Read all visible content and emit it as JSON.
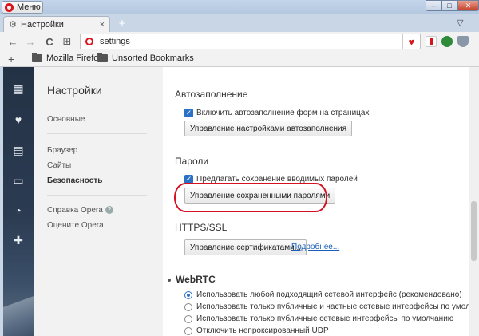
{
  "titlebar": {
    "menu_label": "Меню",
    "minimize": "–",
    "maximize": "□",
    "close": "✕"
  },
  "tab": {
    "label": "Настройки",
    "close": "×",
    "new_tab": "+",
    "tab_menu": "▽"
  },
  "toolbar": {
    "back": "←",
    "forward": "→",
    "reload": "C",
    "speed_dial": "⊞",
    "url": "settings",
    "bookmark": "♥"
  },
  "bookmarks": {
    "add": "+",
    "items": [
      "Mozilla Firefox",
      "Unsorted Bookmarks"
    ]
  },
  "rail": {
    "icons": [
      "▦",
      "♥",
      "▤",
      "▭",
      "◔",
      "✚"
    ]
  },
  "nav": {
    "title": "Настройки",
    "items": {
      "basic": "Основные",
      "browser": "Браузер",
      "sites": "Сайты",
      "security": "Безопасность",
      "help": "Справка Opera",
      "rate": "Оцените Opera"
    },
    "help_icon": "?"
  },
  "content": {
    "autofill": {
      "title": "Автозаполнение",
      "checkbox": "Включить автозаполнение форм на страницах",
      "button": "Управление настройками автозаполнения"
    },
    "passwords": {
      "title": "Пароли",
      "checkbox": "Предлагать сохранение вводимых паролей",
      "button": "Управление сохраненными паролями"
    },
    "https": {
      "title": "HTTPS/SSL",
      "button": "Управление сертификатами...",
      "link": "Подробнее..."
    },
    "webrtc": {
      "title": "WebRTC",
      "options": [
        "Использовать любой подходящий сетевой интерфейс (рекомендовано)",
        "Использовать только публичные и частные сетевые интерфейсы по умолчанию",
        "Использовать только публичные сетевые интерфейсы по умолчанию",
        "Отключить непроксированный UDP"
      ],
      "selected_index": 0
    }
  },
  "colors": {
    "accent": "#2b72c7",
    "opera_red": "#d8141c",
    "highlight": "#d51222"
  }
}
